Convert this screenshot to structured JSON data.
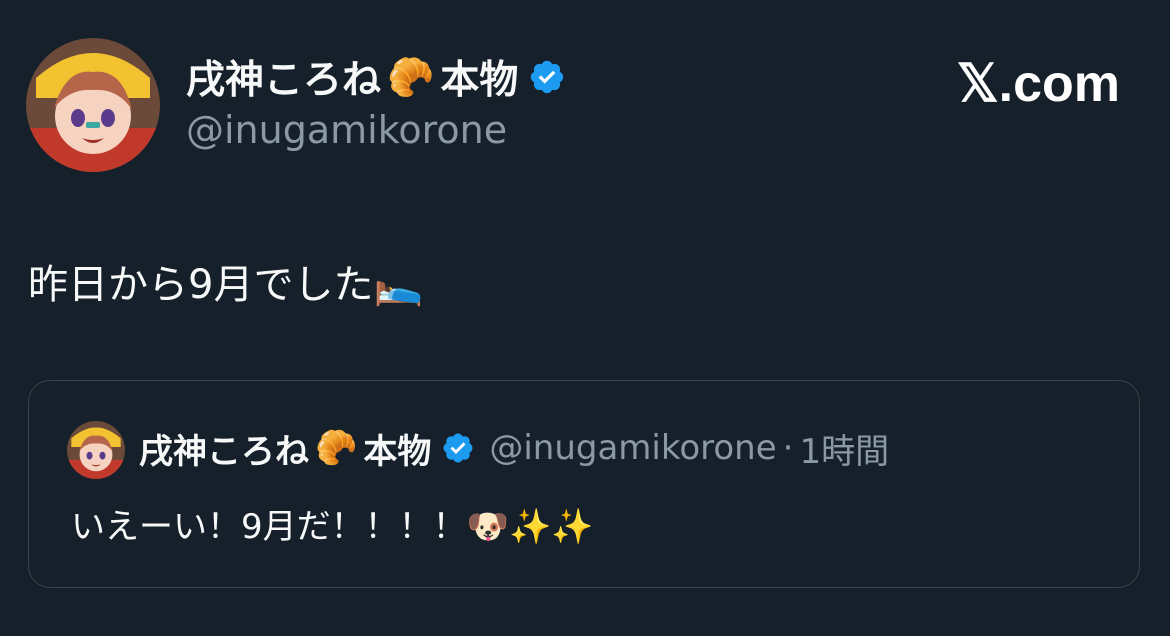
{
  "author": {
    "display_name": "戌神ころね",
    "name_emoji": "🥐",
    "name_suffix": "本物",
    "handle": "@inugamikorone"
  },
  "brand": {
    "label": "𝕏.com"
  },
  "tweet": {
    "text": "昨日から9月でした🛌"
  },
  "quoted": {
    "display_name": "戌神ころね",
    "name_emoji": "🥐",
    "name_suffix": "本物",
    "handle": "@inugamikorone",
    "separator": "·",
    "time": "1時間",
    "text": "いえーい！9月だ！！！！🐶✨✨"
  },
  "colors": {
    "background": "#15202b",
    "text_primary": "#f7f9f9",
    "text_secondary": "#8b98a5",
    "verified_badge": "#1d9bf0",
    "card_border": "#38444d"
  },
  "icons": {
    "verified": "verified-badge-icon",
    "avatar": "user-avatar-image"
  }
}
